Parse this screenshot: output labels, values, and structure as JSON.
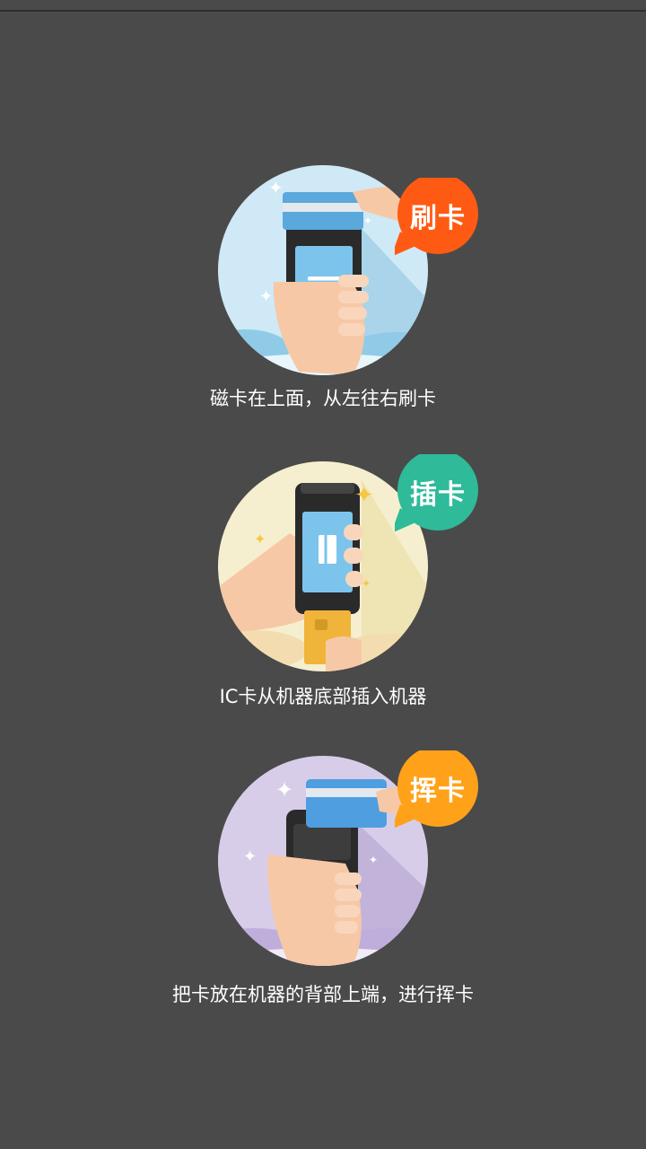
{
  "methods": [
    {
      "badge": "刷卡",
      "badge_color": "#ff5a14",
      "circle_color": "#cfe9f6",
      "caption": "磁卡在上面，从左往右刷卡"
    },
    {
      "badge": "插卡",
      "badge_color": "#2fba9a",
      "circle_color": "#f5efcf",
      "caption": "IC卡从机器底部插入机器"
    },
    {
      "badge": "挥卡",
      "badge_color": "#ffa21a",
      "circle_color": "#d8cde9",
      "caption": "把卡放在机器的背部上端，进行挥卡"
    }
  ]
}
